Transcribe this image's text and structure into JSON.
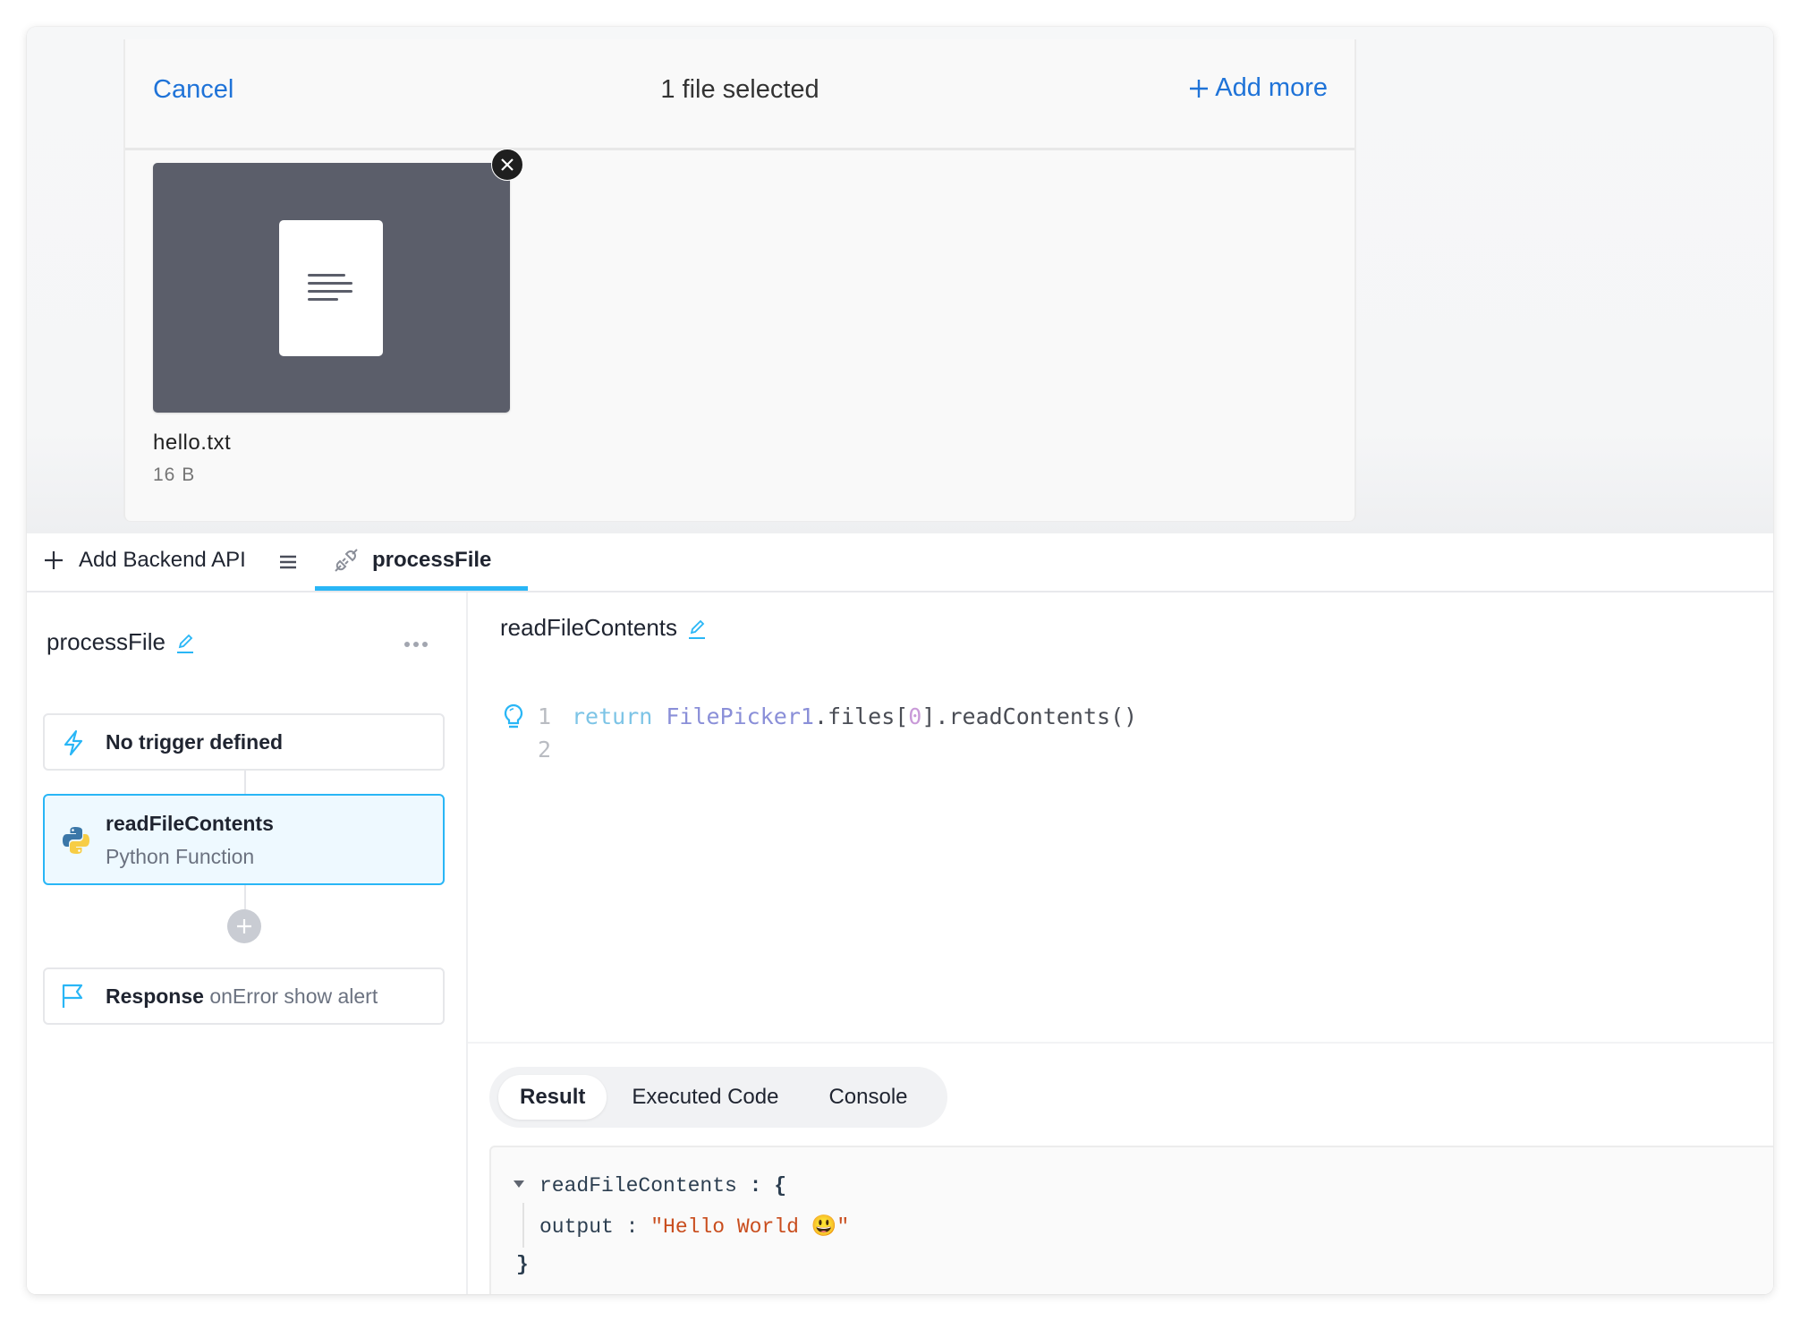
{
  "file_picker": {
    "cancel_label": "Cancel",
    "selected_count": "1 file selected",
    "add_more_label": "Add more",
    "file": {
      "name": "hello.txt",
      "size": "16 B",
      "icon": "text-document-icon"
    }
  },
  "tabs_bar": {
    "add_api_label": "Add Backend API",
    "active_tab_label": "processFile"
  },
  "sidebar": {
    "title": "processFile",
    "trigger": {
      "label": "No trigger defined"
    },
    "step": {
      "title": "readFileContents",
      "subtitle": "Python Function"
    },
    "response": {
      "title": "Response",
      "detail": "onError show alert"
    }
  },
  "editor": {
    "function_name": "readFileContents",
    "lines": [
      {
        "number": "1",
        "tokens": {
          "keyword": "return ",
          "variable": "FilePicker1",
          "p1": ".files[",
          "index": "0",
          "p2": "].readContents()"
        }
      },
      {
        "number": "2"
      }
    ]
  },
  "result_tabs": [
    "Result",
    "Executed Code",
    "Console"
  ],
  "result": {
    "key": "readFileContents",
    "open": " : {",
    "field": "output",
    "sep": " : ",
    "value": "\"Hello World 😃\"",
    "close": "}"
  },
  "colors": {
    "link_blue": "#1f73d8",
    "accent_cyan": "#29b6f6",
    "string_orange": "#c94d1d"
  }
}
